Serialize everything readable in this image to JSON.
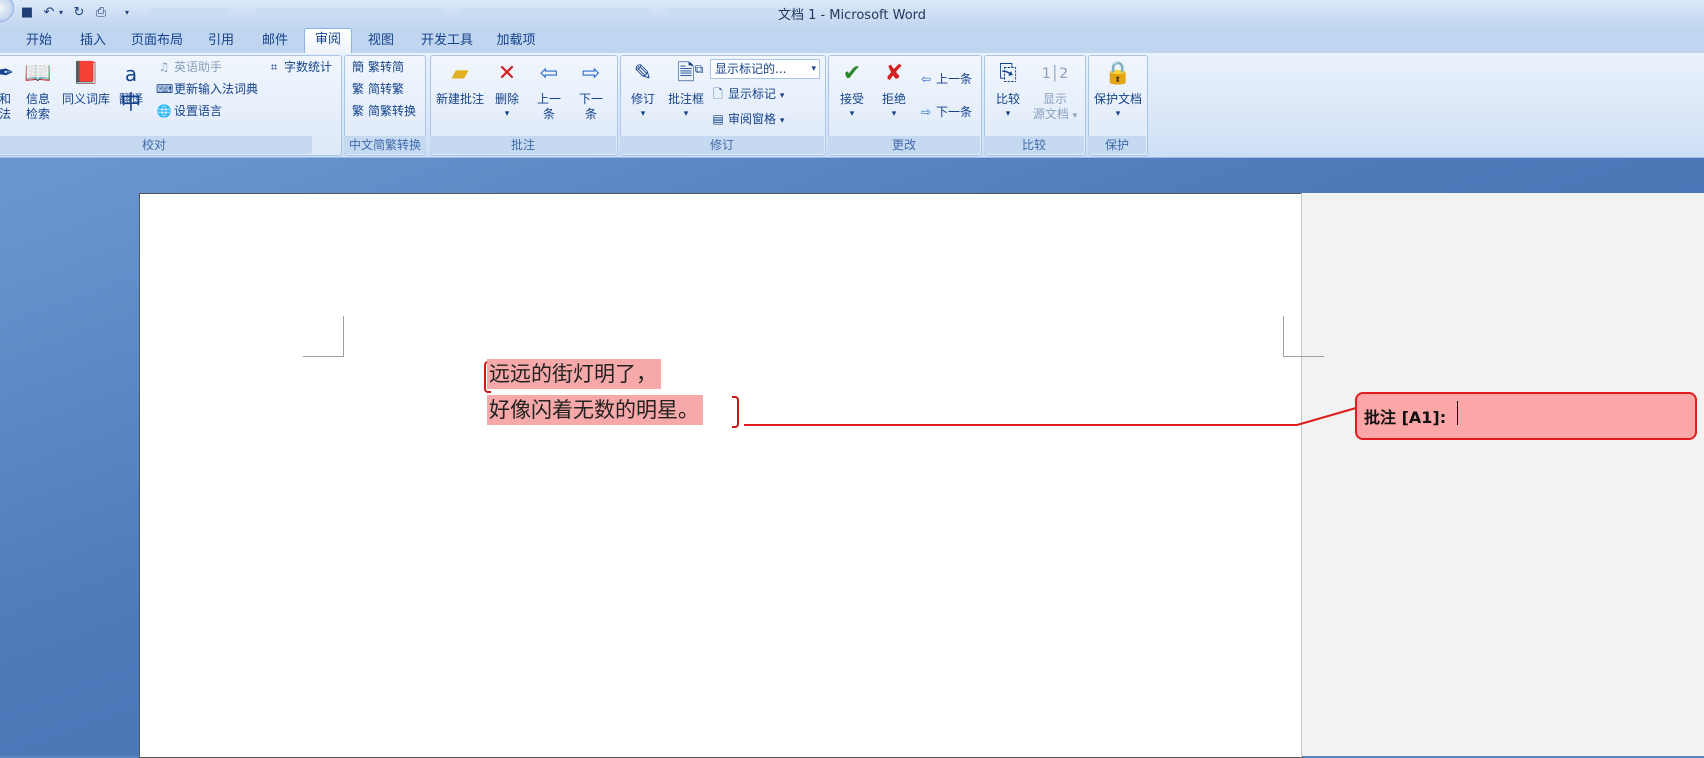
{
  "window": {
    "title": "文档 1 - Microsoft Word"
  },
  "tabs": [
    {
      "label": "开始"
    },
    {
      "label": "插入"
    },
    {
      "label": "页面布局"
    },
    {
      "label": "引用"
    },
    {
      "label": "邮件"
    },
    {
      "label": "审阅"
    },
    {
      "label": "视图"
    },
    {
      "label": "开发工具"
    },
    {
      "label": "加载项"
    }
  ],
  "groups": {
    "proofing": {
      "label": "校对",
      "spell_top": "和",
      "spell_bottom": "法",
      "research_l1": "信息",
      "research_l2": "检索",
      "thesaurus": "同义词库",
      "translate": "翻译",
      "english_assistant": "英语助手",
      "ime_dictionary": "更新输入法词典",
      "set_language": "设置语言",
      "word_count": "字数统计"
    },
    "chinese": {
      "label": "中文简繁转换",
      "to_simplified": "繁转简",
      "to_traditional": "简转繁",
      "convert": "简繁转换"
    },
    "comments": {
      "label": "批注",
      "new": "新建批注",
      "delete": "删除",
      "prev_l1": "上一",
      "prev_l2": "条",
      "next_l1": "下一",
      "next_l2": "条"
    },
    "tracking": {
      "label": "修订",
      "track": "修订",
      "balloons": "批注框",
      "display_dropdown": "显示标记的...",
      "show_markup": "显示标记",
      "reviewing_pane": "审阅窗格"
    },
    "changes": {
      "label": "更改",
      "accept": "接受",
      "reject": "拒绝",
      "previous": "上一条",
      "next": "下一条"
    },
    "compare": {
      "label": "比较",
      "compare": "比较",
      "show_l1": "显示",
      "show_l2": "源文档"
    },
    "protect": {
      "label": "保护",
      "protect_doc": "保护文档"
    }
  },
  "document": {
    "line1": "远远的街灯明了，",
    "line2": "好像闪着无数的明星。"
  },
  "comment": {
    "label": "批注 [A1]:"
  },
  "colors": {
    "highlight": "#f7a8a8",
    "comment_border": "#e01c1c",
    "ribbon_text": "#15428b"
  }
}
